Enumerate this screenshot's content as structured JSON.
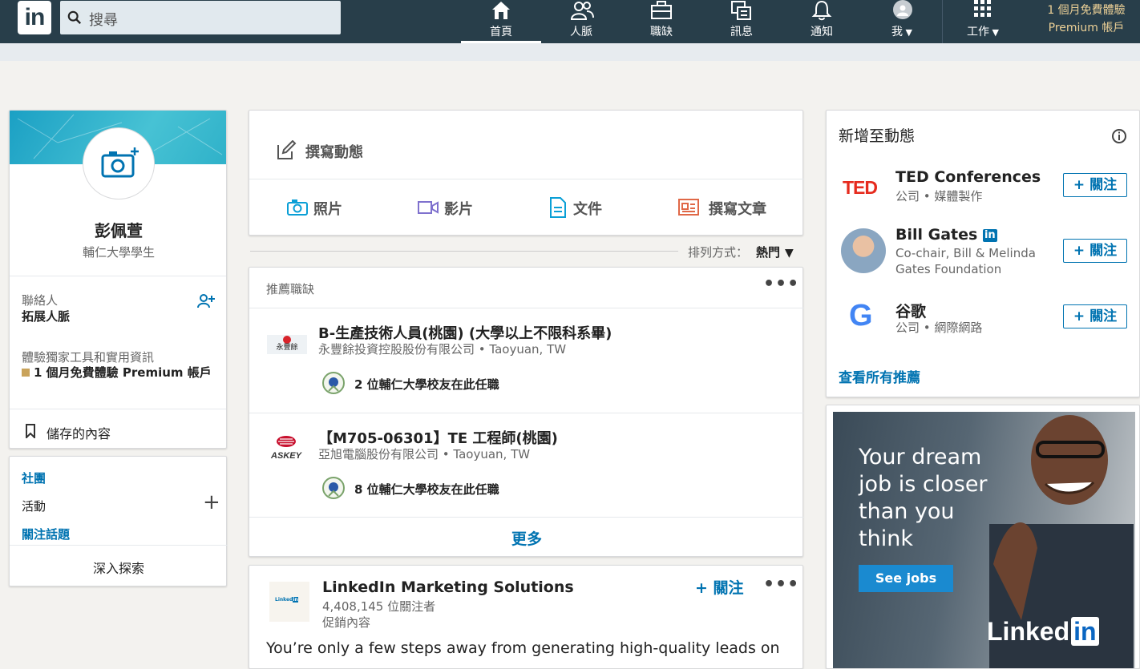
{
  "topnav": {
    "logo": "in",
    "search_placeholder": "搜尋",
    "items": [
      {
        "label": "首頁",
        "icon": "home-icon"
      },
      {
        "label": "人脈",
        "icon": "network-icon"
      },
      {
        "label": "職缺",
        "icon": "jobs-icon"
      },
      {
        "label": "訊息",
        "icon": "messaging-icon"
      },
      {
        "label": "通知",
        "icon": "notifications-icon"
      },
      {
        "label": "我",
        "icon": "avatar-icon"
      },
      {
        "label": "工作",
        "icon": "grid-icon"
      }
    ],
    "premium_line1": "1 個月免費體驗",
    "premium_line2": "Premium 帳戶"
  },
  "profile": {
    "name": "彭佩萱",
    "headline": "輔仁大學學生",
    "connections_label": "聯絡人",
    "connections_action": "拓展人脈",
    "premium_text": "體驗獨家工具和實用資訊",
    "premium_cta": "1 個月免費體驗 Premium 帳戶",
    "saved_label": "儲存的內容"
  },
  "community": {
    "groups": "社團",
    "events": "活動",
    "hashtags": "關注話題",
    "discover": "深入探索"
  },
  "compose": {
    "start_post": "撰寫動態",
    "photo": "照片",
    "video": "影片",
    "document": "文件",
    "article": "撰寫文章"
  },
  "sort": {
    "label": "排列方式：",
    "value": "熱門"
  },
  "jobs": {
    "header": "推薦職缺",
    "items": [
      {
        "title": "B-生產技術人員(桃園) (大學以上不限科系畢)",
        "company": "永豐餘投資控股股份有限公司",
        "location": "Taoyuan, TW",
        "alumni": "2 位輔仁大學校友在此任職",
        "logo_text": "永豐餘"
      },
      {
        "title": "【M705-06301】TE 工程師(桃園)",
        "company": "亞旭電腦股份有限公司",
        "location": "Taoyuan, TW",
        "alumni": "8 位輔仁大學校友在此任職",
        "logo_text": "ASKEY"
      }
    ],
    "more": "更多"
  },
  "sponsored": {
    "name": "LinkedIn Marketing Solutions",
    "followers": "4,408,145 位關注者",
    "tag": "促銷內容",
    "follow": "+ 關注",
    "text": "You’re only a few steps away from generating high-quality leads on"
  },
  "feed_suggestions": {
    "title": "新增至動態",
    "items": [
      {
        "name": "TED Conferences",
        "sub": "公司 • 媒體製作",
        "follow": "+ 關注",
        "logo": "TED"
      },
      {
        "name": "Bill Gates",
        "sub": "Co-chair, Bill & Melinda Gates Foundation",
        "follow": "+ 關注"
      },
      {
        "name": "谷歌",
        "sub": "公司 • 網際網路",
        "follow": "+ 關注",
        "logo": "G"
      }
    ],
    "view_all": "查看所有推薦"
  },
  "ad": {
    "headline_1": "Your dream",
    "headline_2": "job is closer",
    "headline_3": "than you",
    "headline_4": "think",
    "cta": "See jobs",
    "brand": "Linked",
    "brand_in": "in"
  }
}
